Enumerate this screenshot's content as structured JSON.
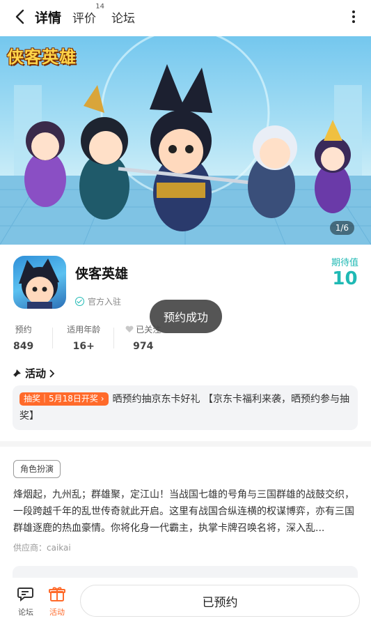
{
  "header": {
    "tabs": [
      {
        "label": "详情",
        "active": true
      },
      {
        "label": "评价",
        "count": "14"
      },
      {
        "label": "论坛"
      }
    ]
  },
  "banner": {
    "logo_text": "侠客英雄",
    "page_indicator": "1/6"
  },
  "app": {
    "name": "侠客英雄",
    "official_label": "官方入驻",
    "expect_label": "期待值",
    "expect_value": "10"
  },
  "stats": [
    {
      "label": "预约",
      "value": "849"
    },
    {
      "label": "适用年龄",
      "value": "16+"
    },
    {
      "label": "已关注",
      "value": "974"
    }
  ],
  "toast": "预约成功",
  "activity": {
    "title": "活动",
    "badge": "抽奖｜5月18日开奖 ›",
    "text": "晒预约抽京东卡好礼 【京东卡福利来袭，晒预约参与抽奖】"
  },
  "detail": {
    "genre": "角色扮演",
    "description": "烽烟起，九州乱；群雄聚，定江山！当战国七雄的号角与三国群雄的战鼓交织，一段跨越千年的乱世传奇就此开启。这里有战国合纵连横的权谋博弈，亦有三国群雄逐鹿的热血豪情。你将化身一代霸主，执掌卡牌召唤名将，深入乱...",
    "supplier": "供应商：caikai"
  },
  "bottom": {
    "forum_label": "论坛",
    "activity_label": "活动",
    "reserve_button": "已预约"
  },
  "colors": {
    "accent": "#1fb9b4",
    "orange": "#ff6a2a"
  }
}
